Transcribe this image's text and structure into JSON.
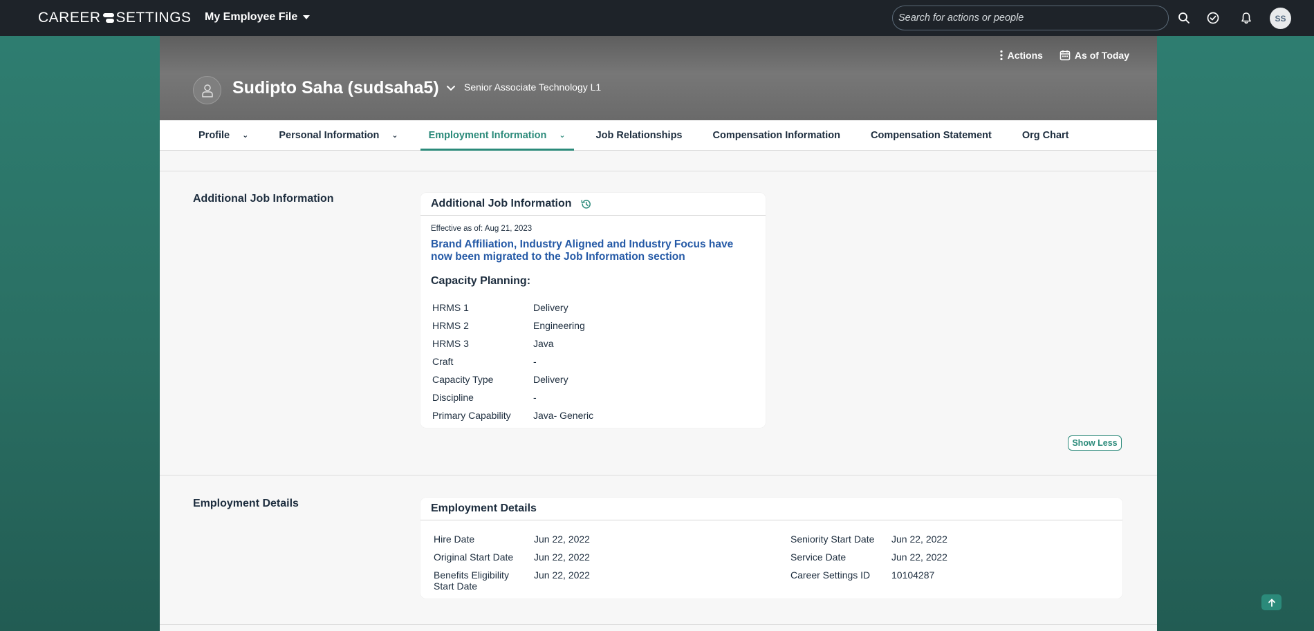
{
  "shell": {
    "brand_left": "CAREER",
    "brand_right": "SETTINGS",
    "app_menu_label": "My Employee File",
    "search_placeholder": "Search for actions or people",
    "avatar_initials": "SS"
  },
  "header": {
    "actions_label": "Actions",
    "as_of_label": "As of Today",
    "employee_name": "Sudipto Saha (sudsaha5)",
    "employee_role": "Senior Associate Technology L1"
  },
  "tabs": [
    {
      "label": "Profile",
      "has_menu": true
    },
    {
      "label": "Personal Information",
      "has_menu": true
    },
    {
      "label": "Employment Information",
      "has_menu": true,
      "active": true
    },
    {
      "label": "Job Relationships",
      "has_menu": false
    },
    {
      "label": "Compensation Information",
      "has_menu": false
    },
    {
      "label": "Compensation Statement",
      "has_menu": false
    },
    {
      "label": "Org Chart",
      "has_menu": false
    }
  ],
  "additional_job": {
    "section_title": "Additional Job Information",
    "card_title": "Additional Job Information",
    "effective": "Effective as of: Aug 21, 2023",
    "migrated_notice": "Brand Affiliation, Industry Aligned and Industry Focus have now been migrated to the Job Information section",
    "capacity_title": "Capacity Planning:",
    "fields": [
      {
        "label": "HRMS 1",
        "value": "Delivery"
      },
      {
        "label": "HRMS 2",
        "value": "Engineering"
      },
      {
        "label": "HRMS 3",
        "value": "Java"
      },
      {
        "label": "Craft",
        "value": "-"
      },
      {
        "label": "Capacity Type",
        "value": "Delivery"
      },
      {
        "label": "Discipline",
        "value": "-"
      },
      {
        "label": "Primary Capability",
        "value": "Java- Generic"
      }
    ],
    "show_less_label": "Show Less"
  },
  "employment_details": {
    "section_title": "Employment Details",
    "card_title": "Employment Details",
    "left_fields": [
      {
        "label": "Hire Date",
        "value": "Jun 22, 2022"
      },
      {
        "label": "Original Start Date",
        "value": "Jun 22, 2022"
      },
      {
        "label": "Benefits Eligibility Start Date",
        "value": "Jun 22, 2022"
      }
    ],
    "right_fields": [
      {
        "label": "Seniority Start Date",
        "value": "Jun 22, 2022"
      },
      {
        "label": "Service Date",
        "value": "Jun 22, 2022"
      },
      {
        "label": "Career Settings ID",
        "value": "10104287"
      }
    ]
  },
  "colors": {
    "accent": "#2b8a7a",
    "link": "#2459a6",
    "shell_bg": "#1e2329",
    "page_bg": "#2f7f72"
  },
  "icons": [
    "search-icon",
    "task-check-icon",
    "bell-icon",
    "more-vertical-icon",
    "calendar-icon",
    "person-icon",
    "chevron-down-icon",
    "history-icon",
    "arrow-up-icon"
  ]
}
